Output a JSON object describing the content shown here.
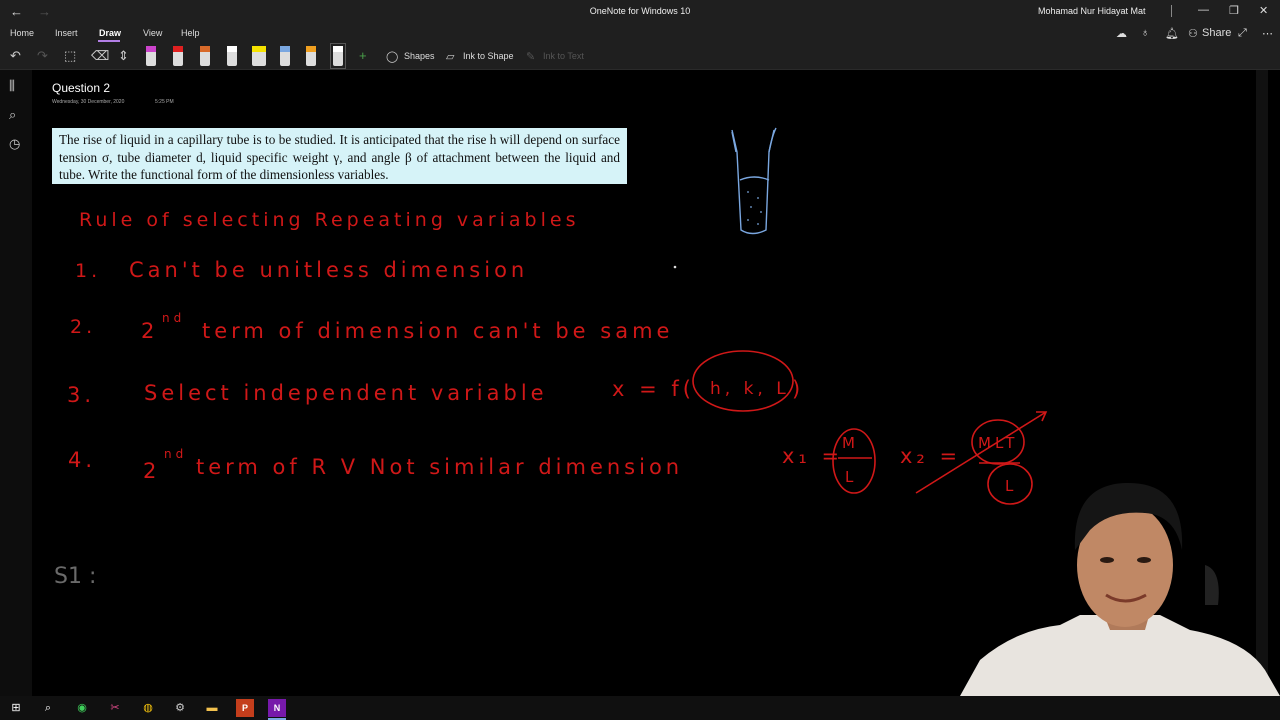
{
  "window": {
    "back_icon": "←",
    "forward_icon": "→",
    "title": "OneNote for Windows 10",
    "user": "Mohamad Nur Hidayat Mat",
    "minimize": "—",
    "restore": "❐",
    "close": "✕"
  },
  "ribbon": {
    "tabs": [
      "Home",
      "Insert",
      "Draw",
      "View",
      "Help"
    ],
    "active_tab": "Draw",
    "share_label": "Share",
    "tools": {
      "shapes_label": "Shapes",
      "ink_to_shape_label": "Ink to Shape",
      "ink_to_text_label": "Ink to Text"
    },
    "pen_colors": [
      "#cc44cc",
      "#e02020",
      "#d86a2a",
      "#ffffff",
      "#f5e200",
      "#7aa7e0",
      "#f0a020",
      "#ffffff"
    ]
  },
  "page": {
    "title": "Question 2",
    "date": "Wednesday, 30 December, 2020",
    "time": "5:25 PM",
    "question_text": "The rise of liquid in a capillary tube is to be studied. It is anticipated that the rise h will depend on surface tension σ, tube diameter d, liquid specific weight γ, and angle β of attachment between the liquid and tube. Write the functional form of the dimensionless variables."
  },
  "handwriting": {
    "heading": "Rule of selecting Repeating variables",
    "rule1_num": "1.",
    "rule1": "Can't be unitless dimension",
    "rule2_num": "2.",
    "rule2_pre": "2",
    "rule2_sup": "nd",
    "rule2": "term of dimension can't be same",
    "rule3_num": "3.",
    "rule3": "Select independent variable",
    "rule3_eq": "x = f(",
    "rule3_vars": "h, k, L",
    "rule3_close": ")",
    "rule4_num": "4.",
    "rule4_pre": "2",
    "rule4_sup": "nd",
    "rule4": "term of R V Not similar dimension",
    "rule4_x1": "x₁ =",
    "rule4_x1_top": "M",
    "rule4_x1_bot": "L",
    "rule4_x2": "x₂ =",
    "rule4_x2_top": "MLT",
    "rule4_x2_bot": "L",
    "s1": "S1 :"
  },
  "taskbar": {
    "icons": [
      "windows-start",
      "search",
      "whatsapp",
      "snip",
      "chrome",
      "settings",
      "file-explorer",
      "powerpoint",
      "onenote"
    ]
  }
}
